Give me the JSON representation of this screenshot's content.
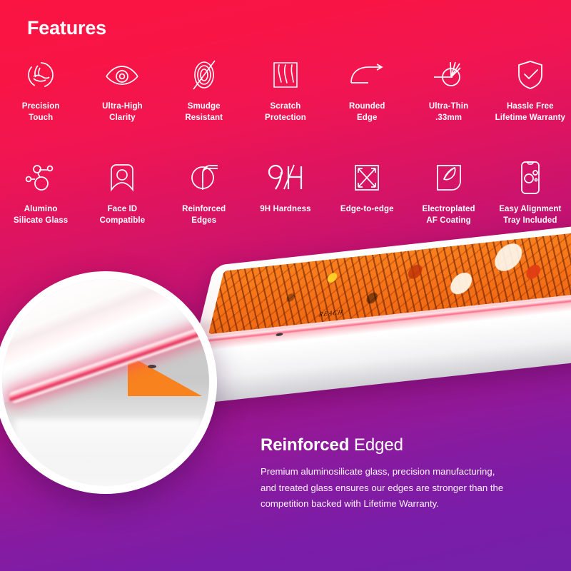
{
  "theme": {
    "gradient_top": "#fb1442",
    "gradient_mid": "#bd1277",
    "gradient_bottom": "#7420a8",
    "text_color": "#ffffff",
    "screen_orange": "#f7821e",
    "edge_glow_pink": "#f6486e"
  },
  "header": {
    "title": "Features"
  },
  "features": {
    "row1": [
      {
        "icon": "precision-touch-icon",
        "label": "Precision\nTouch"
      },
      {
        "icon": "eye-clarity-icon",
        "label": "Ultra-High\nClarity"
      },
      {
        "icon": "smudge-resistant-icon",
        "label": "Smudge\nResistant"
      },
      {
        "icon": "scratch-protection-icon",
        "label": "Scratch\nProtection"
      },
      {
        "icon": "rounded-edge-icon",
        "label": "Rounded\nEdge"
      },
      {
        "icon": "ultra-thin-caliper-icon",
        "label": "Ultra-Thin\n.33mm"
      },
      {
        "icon": "shield-check-icon",
        "label": "Hassle Free\nLifetime Warranty"
      }
    ],
    "row2": [
      {
        "icon": "molecule-icon",
        "label": "Alumino\nSilicate Glass"
      },
      {
        "icon": "face-id-icon",
        "label": "Face ID\nCompatible"
      },
      {
        "icon": "reinforced-edge-icon",
        "label": "Reinforced\nEdges"
      },
      {
        "icon": "hardness-9h-icon",
        "label": "9H Hardness"
      },
      {
        "icon": "edge-to-edge-icon",
        "label": "Edge-to-edge"
      },
      {
        "icon": "af-coating-icon",
        "label": "Electroplated\nAF Coating"
      },
      {
        "icon": "alignment-tray-icon",
        "label": "Easy Alignment\nTray Included"
      }
    ]
  },
  "product_scene": {
    "device_screen_word": "REACH",
    "magnifier_label": "reinforced-edge-closeup"
  },
  "callout": {
    "title_bold": "Reinforced",
    "title_light": " Edged",
    "body": "Premium aluminosilicate glass, precision manufacturing,\nand treated glass ensures our edges are stronger than the\ncompetition backed with Lifetime Warranty."
  }
}
